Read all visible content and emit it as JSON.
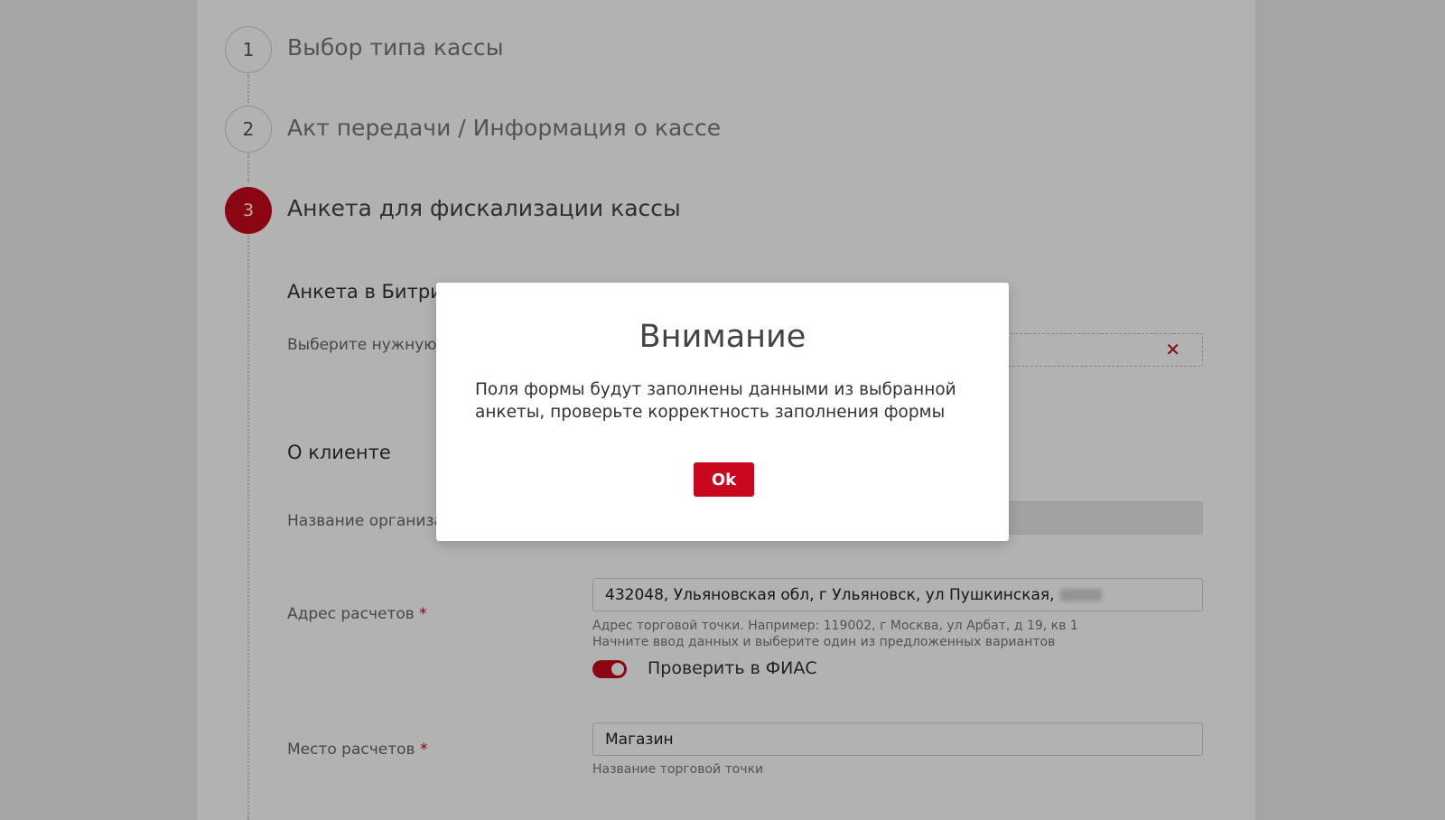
{
  "steps": [
    {
      "number": "1",
      "title": "Выбор типа кассы"
    },
    {
      "number": "2",
      "title": "Акт передачи / Информация о кассе"
    },
    {
      "number": "3",
      "title": "Анкета для фискализации кассы"
    }
  ],
  "form": {
    "bitrix_section": {
      "title": "Анкета в Битрикс",
      "select_label": "Выберите нужную ан"
    },
    "client_section": {
      "title": "О клиенте",
      "org_name_label": "Название организац"
    },
    "address": {
      "label": "Адрес расчетов",
      "required_mark": "*",
      "value": "432048, Ульяновская обл, г Ульяновск, ул Пушкинская,",
      "hint_line1": "Адрес торговой точки. Например: 119002, г Москва, ул Арбат, д 19, кв 1",
      "hint_line2": "Начните ввод данных и выберите один из предложенных вариантов",
      "fias_toggle_label": "Проверить в ФИАС",
      "fias_toggle_on": true
    },
    "place": {
      "label": "Место расчетов",
      "required_mark": "*",
      "value": "Магазин",
      "hint": "Название торговой точки"
    }
  },
  "modal": {
    "title": "Внимание",
    "text_line1": "Поля формы будут заполнены данными из выбранной",
    "text_line2": "анкеты, проверьте корректность заполнения формы",
    "ok_label": "Ok"
  },
  "colors": {
    "accent": "#c8081c",
    "overlay": "rgba(0,0,0,0.30)"
  },
  "icons": {
    "clear": "close-icon"
  }
}
